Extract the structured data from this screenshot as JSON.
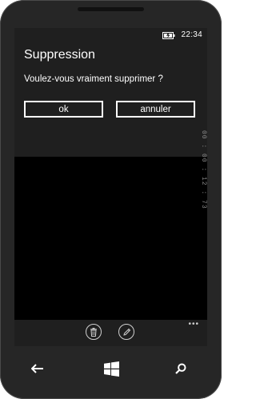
{
  "status_bar": {
    "time": "22:34",
    "battery_icon": "battery-charging-icon"
  },
  "dialog": {
    "title": "Suppression",
    "message": "Voulez-vous vraiment supprimer ?",
    "buttons": {
      "ok": "ok",
      "cancel": "annuler"
    }
  },
  "side_text": "00 : 00 : 12 : 73",
  "app_bar": {
    "buttons": [
      {
        "icon": "trash-icon"
      },
      {
        "icon": "pencil-icon"
      }
    ],
    "more": "•••"
  },
  "nav_bar": {
    "back_icon": "back-arrow-icon",
    "start_icon": "windows-start-icon",
    "search_icon": "search-icon"
  },
  "colors": {
    "background": "#000000",
    "dialog": "#1f1f1f",
    "text": "#ffffff",
    "phone_body": "#262626"
  }
}
